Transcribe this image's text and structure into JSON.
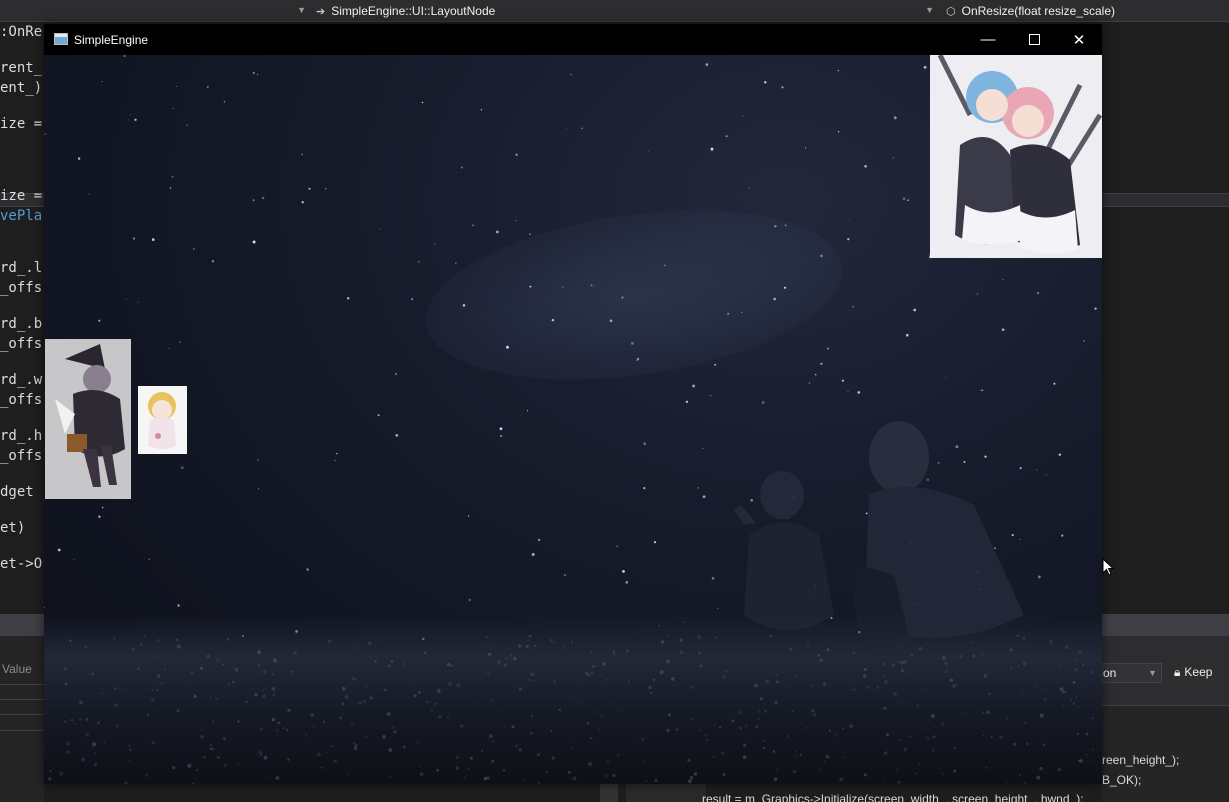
{
  "ide": {
    "nav": {
      "left_combo": "",
      "middle_combo": "SimpleEngine::UI::LayoutNode",
      "right_combo": "OnResize(float resize_scale)"
    },
    "code_lines": [
      ":OnRe",
      "rent_",
      "ent_)",
      "ize =",
      "ize =",
      "vePla",
      "rd_.l",
      "_offs",
      "rd_.b",
      "_offs",
      "rd_.w",
      "_offs",
      "rd_.h",
      "_offs",
      "dget",
      "et)",
      "et->O"
    ],
    "panel_left": {
      "column_header": "Value"
    },
    "output": {
      "select_value": "on",
      "keep_label": "Keep",
      "lines": [
        "reen_height_);",
        "B_OK);"
      ]
    },
    "bottom_code": "result = m_Graphics->Initialize(screen_width_, screen_height_, hwnd_);"
  },
  "window": {
    "title": "SimpleEngine",
    "minimize_glyph": "—",
    "close_glyph": "✕"
  },
  "colors": {
    "ide_bg": "#1e1e1e",
    "ide_chrome": "#2d2d30",
    "keyword_blue": "#569cd6",
    "night_sky": "#151a29"
  },
  "icons": {
    "app": "window-app-icon",
    "minimize": "minimize-icon",
    "maximize": "maximize-icon",
    "close": "close-icon",
    "lock": "lock-icon",
    "cursor": "mouse-cursor-icon"
  }
}
